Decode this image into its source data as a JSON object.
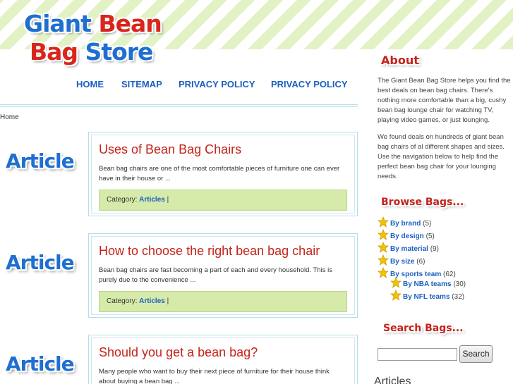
{
  "logo": {
    "line1_word1": "Giant",
    "line1_word2": "Bean",
    "line2_word1": "Bag",
    "line2_word2": "Store"
  },
  "nav": {
    "home": "HOME",
    "sitemap": "SITEMAP",
    "privacy1": "PRIVACY POLICY",
    "privacy2": "PRIVACY POLICY"
  },
  "breadcrumb": "Home",
  "posts": [
    {
      "badge": "Article",
      "title": "Uses of Bean Bag Chairs",
      "excerpt": "Bean bag chairs are one of the most comfortable pieces of furniture one can ever have in their house or ...",
      "cat_label": "Category:",
      "cat_link": "Articles",
      "cat_sep": "|"
    },
    {
      "badge": "Article",
      "title": "How to choose the right bean bag chair",
      "excerpt": "Bean bag chairs are fast becoming a part of each and every household. This is purely due to the convenience ...",
      "cat_label": "Category:",
      "cat_link": "Articles",
      "cat_sep": "|"
    },
    {
      "badge": "Article",
      "title": "Should you get a bean bag?",
      "excerpt": "Many people who want to buy their next piece of furniture for their house think about buying a bean bag ..."
    }
  ],
  "sidebar": {
    "about_heading": "About",
    "about_p1": "The Giant Bean Bag Store helps you find the best deals on bean bag chairs. There's nothing more comfortable than a big, cushy bean bag lounge chair for watching TV, playing video games, or just lounging.",
    "about_p2": "We found deals on hundreds of giant bean bag chairs of al different shapes and sizes. Use the navigation below to help find the perfect bean bag chair for your lounging needs.",
    "browse_heading": "Browse Bags...",
    "browse": [
      {
        "label": "By brand",
        "count": "(5)"
      },
      {
        "label": "By design",
        "count": "(5)"
      },
      {
        "label": "By material",
        "count": "(9)"
      },
      {
        "label": "By size",
        "count": "(6)"
      },
      {
        "label": "By sports team",
        "count": "(62)"
      },
      {
        "label": "By NBA teams",
        "count": "(30)"
      },
      {
        "label": "By NFL teams",
        "count": "(32)"
      }
    ],
    "search_heading": "Search Bags...",
    "search_button": "Search",
    "articles_heading": "Articles"
  },
  "colors": {
    "blue": "#1b5fc0",
    "red": "#c5221a",
    "green_bg": "#d6eaa9"
  }
}
